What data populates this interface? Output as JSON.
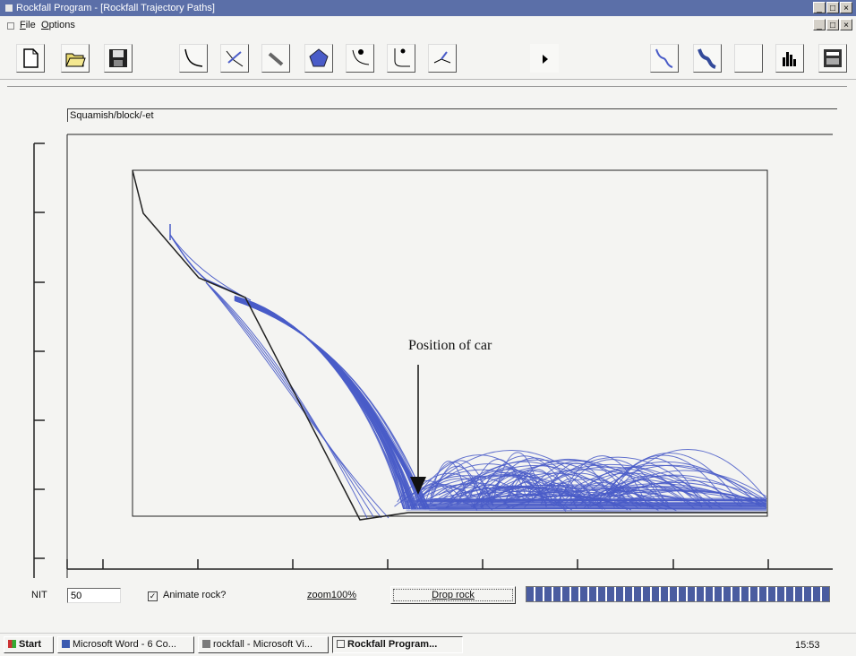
{
  "window": {
    "title": "Rockfall Program - [Rockfall Trajectory Paths]",
    "title_controls": [
      "_",
      "□",
      "×"
    ],
    "mdi_controls": [
      "_",
      "□",
      "×"
    ]
  },
  "menu": {
    "file": "File",
    "options": "Options"
  },
  "toolbar": {
    "buttons": [
      "new-file-icon",
      "open-folder-icon",
      "save-disk-icon",
      "slope-curve-icon",
      "slope-points-icon",
      "barrier-icon",
      "polygon-icon",
      "rock-release-icon",
      "path-icon",
      "barrier-point-icon",
      "play-icon",
      "trajectory-icon",
      "trajectory-bold-icon",
      "blank-icon",
      "histogram-icon",
      "calculator-icon"
    ]
  },
  "document": {
    "path": "Squamish/block/-et"
  },
  "annotation": {
    "label": "Position of car"
  },
  "controls": {
    "nit_label": "NIT",
    "nit_value": "50",
    "animate_label": "Animate rock?",
    "animate_checked": true,
    "animate_mark": "✓",
    "zoom_label": "zoom100%",
    "drop_label": "Drop rock",
    "progress": 1.0
  },
  "taskbar": {
    "start": "Start",
    "tasks": [
      "Microsoft Word - 6 Co...",
      "rockfall - Microsoft Vi...",
      "Rockfall Program..."
    ],
    "active_task": 2,
    "clock": "15:53"
  },
  "colors": {
    "titlebar": "#5b6fa8",
    "trajectory": "#4a5cc8",
    "slope": "#222222"
  }
}
